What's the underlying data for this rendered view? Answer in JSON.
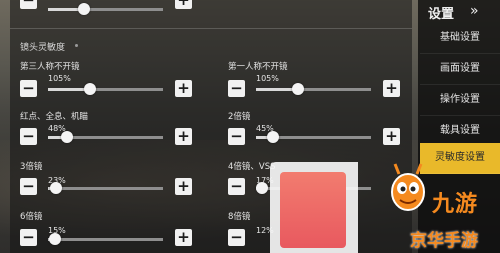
{
  "section": {
    "title": "镜头灵敏度"
  },
  "top_partial": {
    "minus": "−",
    "plus": "+"
  },
  "sliders": [
    {
      "label": "第三人称不开镜",
      "percent": "105%",
      "value": 105,
      "minus": "−",
      "plus": "+"
    },
    {
      "label": "第一人称不开镜",
      "percent": "105%",
      "value": 105,
      "minus": "−",
      "plus": "+"
    },
    {
      "label": "红点、全息、机瞄",
      "percent": "48%",
      "value": 48,
      "minus": "−",
      "plus": "+"
    },
    {
      "label": "2倍镜",
      "percent": "45%",
      "value": 45,
      "minus": "−",
      "plus": "+"
    },
    {
      "label": "3倍镜",
      "percent": "23%",
      "value": 23,
      "minus": "−",
      "plus": "+"
    },
    {
      "label": "4倍镜、VSS",
      "percent": "17%",
      "value": 17,
      "minus": "−",
      "plus": "+"
    },
    {
      "label": "6倍镜",
      "percent": "15%",
      "value": 15,
      "minus": "−",
      "plus": "+"
    },
    {
      "label": "8倍镜",
      "percent": "12%",
      "value": 12,
      "minus": "−",
      "plus": "+"
    }
  ],
  "sidebar": {
    "title": "设置",
    "chevron": "»",
    "items": [
      {
        "label": "基础设置"
      },
      {
        "label": "画面设置"
      },
      {
        "label": "操作设置"
      },
      {
        "label": "载具设置"
      },
      {
        "label": "灵敏度设置"
      }
    ],
    "active_index": 4,
    "accent_color": "#e9b92a"
  },
  "watermark": {
    "brand": "九游",
    "sub": "京华手游",
    "brand_color": "#f58a1f"
  }
}
